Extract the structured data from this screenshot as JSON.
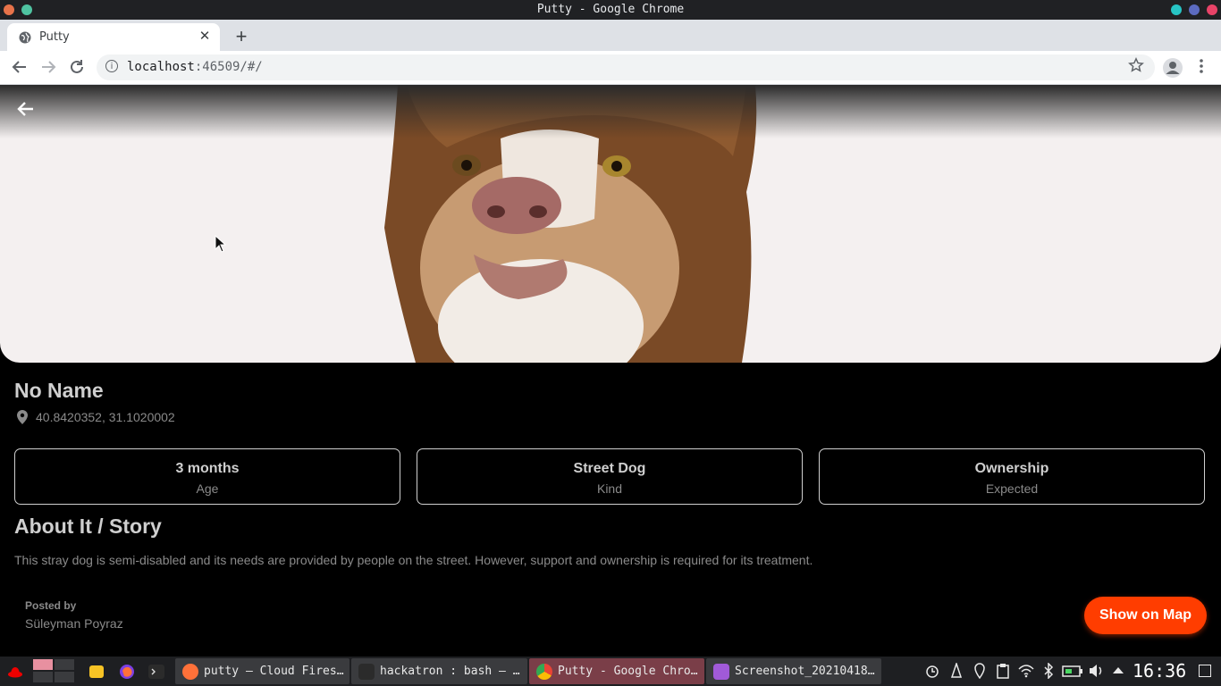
{
  "window": {
    "title": "Putty - Google Chrome",
    "colors": {
      "left_dot_1": "#e8734a",
      "left_dot_2": "#4fc3a1",
      "right_dot_1": "#27c4c4",
      "right_dot_2": "#5c6bc0",
      "right_dot_3": "#e84368"
    }
  },
  "browser": {
    "tab_title": "Putty",
    "tab_close": "✕",
    "new_tab": "+",
    "url_host": "localhost",
    "url_rest": ":46509/#/",
    "info_icon": "i"
  },
  "app": {
    "pet": {
      "name": "No Name",
      "location": "40.8420352, 31.1020002"
    },
    "stats": [
      {
        "value": "3 months",
        "label": "Age"
      },
      {
        "value": "Street Dog",
        "label": "Kind"
      },
      {
        "value": "Ownership",
        "label": "Expected"
      }
    ],
    "about_title": "About It / Story",
    "story": "This stray dog is semi-disabled and its needs are provided by people on the street. However, support and ownership is required for its treatment.",
    "posted_by_label": "Posted by",
    "poster_name": "Süleyman Poyraz",
    "map_button": "Show on Map",
    "accent_color": "#ff3d00"
  },
  "taskbar": {
    "tasks": [
      {
        "label": "putty – Cloud Fires…",
        "active": false
      },
      {
        "label": "hackatron : bash — …",
        "active": false
      },
      {
        "label": "Putty - Google Chro…",
        "active": true
      },
      {
        "label": "Screenshot_20210418…",
        "active": false
      }
    ],
    "clock": "16:36"
  }
}
